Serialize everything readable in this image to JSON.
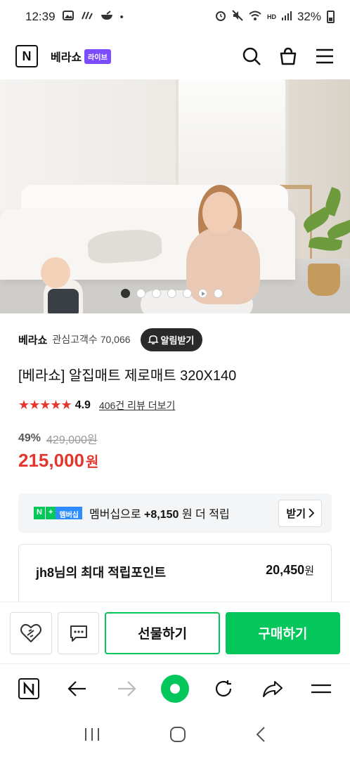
{
  "status_bar": {
    "time": "12:39",
    "battery": "32%",
    "network": "HD"
  },
  "header": {
    "logo_letter": "N",
    "brand": "베라쇼",
    "live_badge": "라이브"
  },
  "carousel": {
    "total_slides": 7,
    "active_index": 0
  },
  "seller": {
    "name": "베라쇼",
    "fans_label": "관심고객수 70,066",
    "notify_label": "알림받기"
  },
  "product": {
    "title": "[베라쇼] 알집매트 제로매트 320X140",
    "stars": "★★★★★",
    "rating": "4.9",
    "reviews_link": "406건 리뷰 더보기",
    "discount": "49%",
    "original_price": "429,000원",
    "price": "215,000",
    "currency": "원"
  },
  "membership": {
    "n_badge": "N",
    "plus_badge": "+",
    "member_badge": "멤버십",
    "text_prefix": "멤버십으로 ",
    "points": "+8,150",
    "text_suffix": "원 더 적립",
    "receive_label": "받기"
  },
  "points_box": {
    "label": "jh8님의 최대 적립포인트",
    "value": "20,450",
    "unit": "원"
  },
  "actions": {
    "gift_label": "선물하기",
    "buy_label": "구매하기"
  },
  "colors": {
    "accent_green": "#03c75a",
    "price_red": "#e3372d",
    "live_purple": "#7b4dff"
  }
}
